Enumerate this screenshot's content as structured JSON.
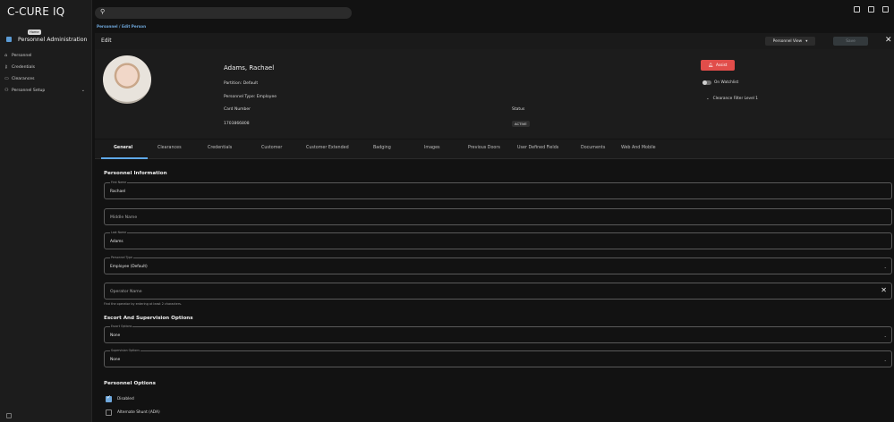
{
  "app": {
    "brand": "C-CURE IQ",
    "home_tooltip": "Home"
  },
  "sidebar": {
    "section_label": "Personnel Administration",
    "items": [
      {
        "icon": "home-icon",
        "label": "Personnel"
      },
      {
        "icon": "key-icon",
        "label": "Credentials"
      },
      {
        "icon": "badge-icon",
        "label": "Clearances"
      },
      {
        "icon": "users-icon",
        "label": "Personnel Setup"
      }
    ]
  },
  "breadcrumb": "Personnel / Edit Person",
  "editbar": {
    "title": "Edit",
    "view_label": "Personnel View",
    "save_label": "Save",
    "close": "✕"
  },
  "profile": {
    "name": "Adams, Rachael",
    "partition": "Partition: Default",
    "personnel_type": "Personnel Type: Employee",
    "card_number_label": "Card Number",
    "card_number": "1703866808",
    "status_label": "Status",
    "status": "ACTIVE",
    "assist_label": "Assist",
    "watchlist_label": "On Watchlist",
    "clearance_filter": "Clearance Filter Level 1"
  },
  "tabs": [
    "General",
    "Clearances",
    "Credentials",
    "Customer",
    "Customer Extended",
    "Badging",
    "Images",
    "Previous Doors",
    "User Defined Fields",
    "Documents",
    "Web And Mobile"
  ],
  "form": {
    "personnel_info_title": "Personnel Information",
    "first_name_label": "First Name",
    "first_name": "Rachael",
    "middle_name_placeholder": "Middle Name",
    "last_name_label": "Last Name",
    "last_name": "Adams",
    "personnel_type_label": "Personnel Type",
    "personnel_type": "Employee (Default)",
    "operator_placeholder": "Operator Name",
    "operator_hint": "Find the operator by entering at least 2 characters.",
    "escort_title": "Escort And Supervision Options",
    "escort_label": "Escort Options",
    "escort_value": "None",
    "supervision_label": "Supervision Options",
    "supervision_value": "None",
    "options_title": "Personnel Options",
    "opt_disabled": "Disabled",
    "opt_alternate_shunt": "Alternate Shunt (ADA)"
  },
  "colors": {
    "accent": "#5fa8e8",
    "assist": "#e14d4a",
    "bg": "#121212"
  }
}
